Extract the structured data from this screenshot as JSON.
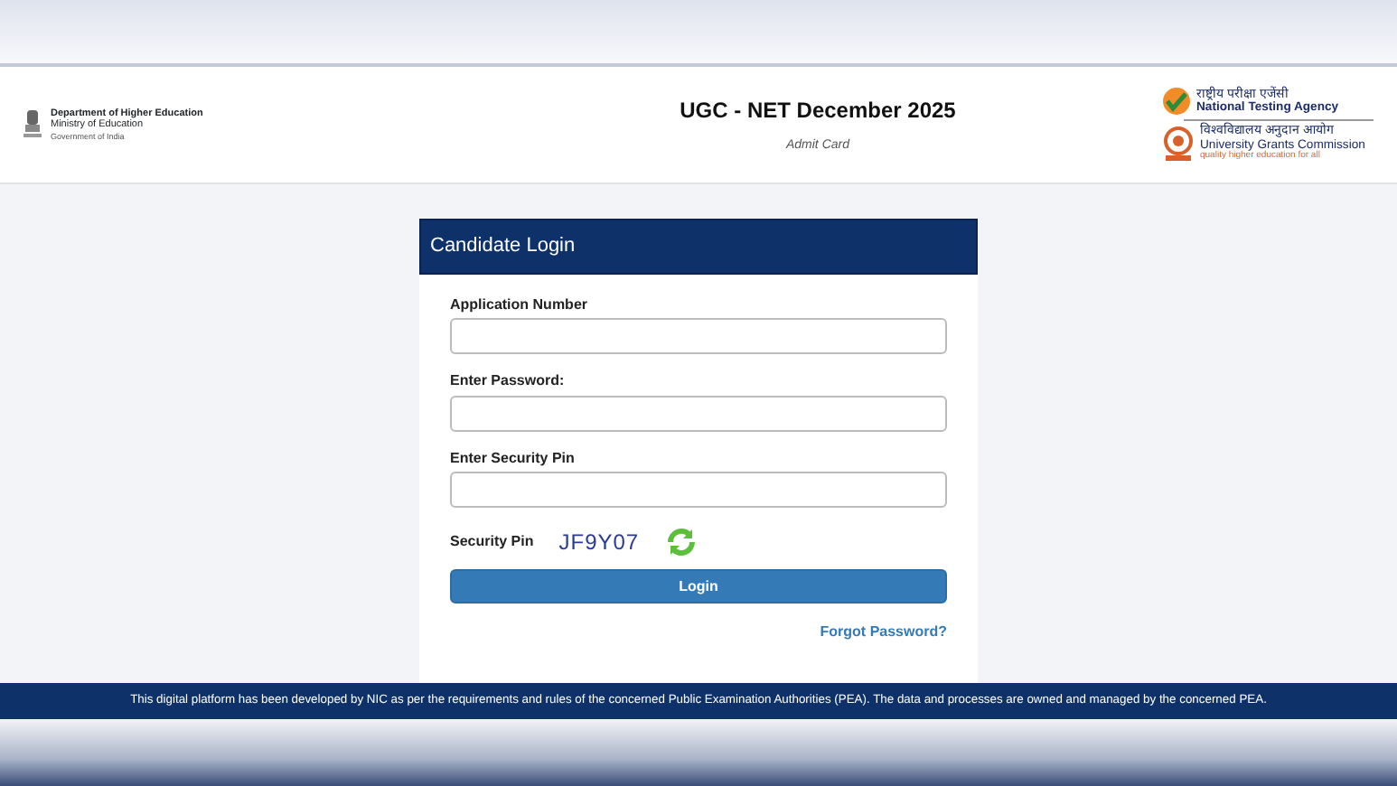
{
  "header": {
    "left_logo": {
      "lines": [
        "Department of Higher Education",
        "Ministry of Education",
        "Government of India"
      ]
    },
    "title": "UGC - NET December 2025",
    "subtitle": "Admit Card",
    "right_logos": [
      {
        "kind": "nta",
        "hindi": "राष्ट्रीय परीक्षा एजेंसी",
        "english": "National Testing Agency"
      },
      {
        "kind": "ugc",
        "hindi": "विश्वविद्यालय अनुदान आयोग",
        "english": "University Grants Commission",
        "tagline": "quality higher education for all"
      }
    ]
  },
  "login": {
    "title": "Candidate Login",
    "fields": [
      {
        "label": "Application Number"
      },
      {
        "label": "Enter Password:"
      },
      {
        "label": "Enter Security Pin"
      }
    ],
    "security_pin": {
      "label": "Security Pin",
      "code": "JF9Y07"
    },
    "button": "Login",
    "forgot": "Forgot Password?"
  },
  "footer": "This digital platform has been developed by NIC as per the requirements and rules of the concerned Public Examination Authorities (PEA). The data and processes are owned and managed by the concerned PEA."
}
